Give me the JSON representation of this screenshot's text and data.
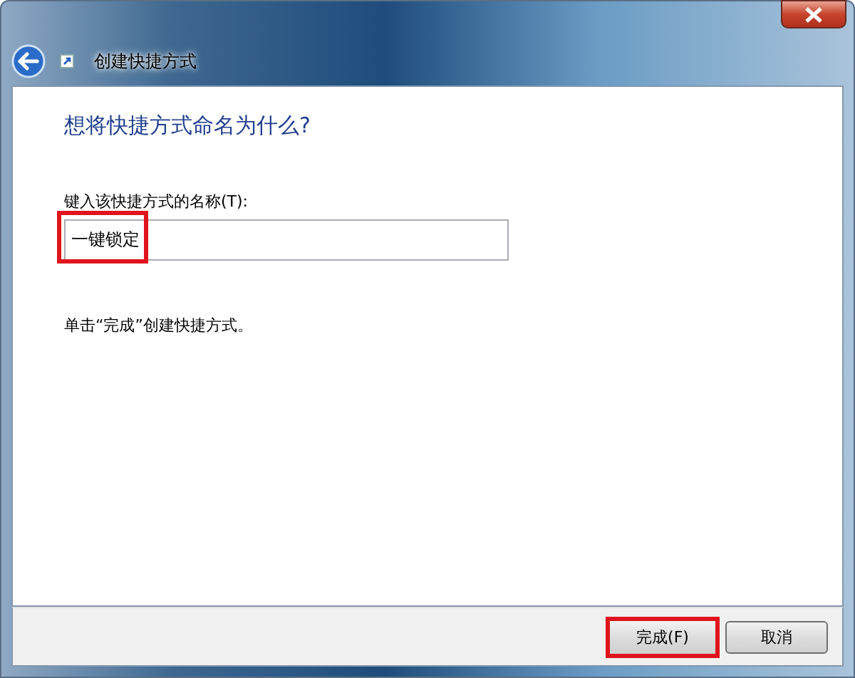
{
  "window": {
    "title": "创建快捷方式"
  },
  "heading": "想将快捷方式命名为什么?",
  "name_field": {
    "label": "键入该快捷方式的名称(T):",
    "value": "一键锁定",
    "highlighted": true
  },
  "hint": "单击“完成”创建快捷方式。",
  "buttons": [
    {
      "label": "完成(F)",
      "highlighted": true
    },
    {
      "label": "取消",
      "highlighted": false
    }
  ]
}
